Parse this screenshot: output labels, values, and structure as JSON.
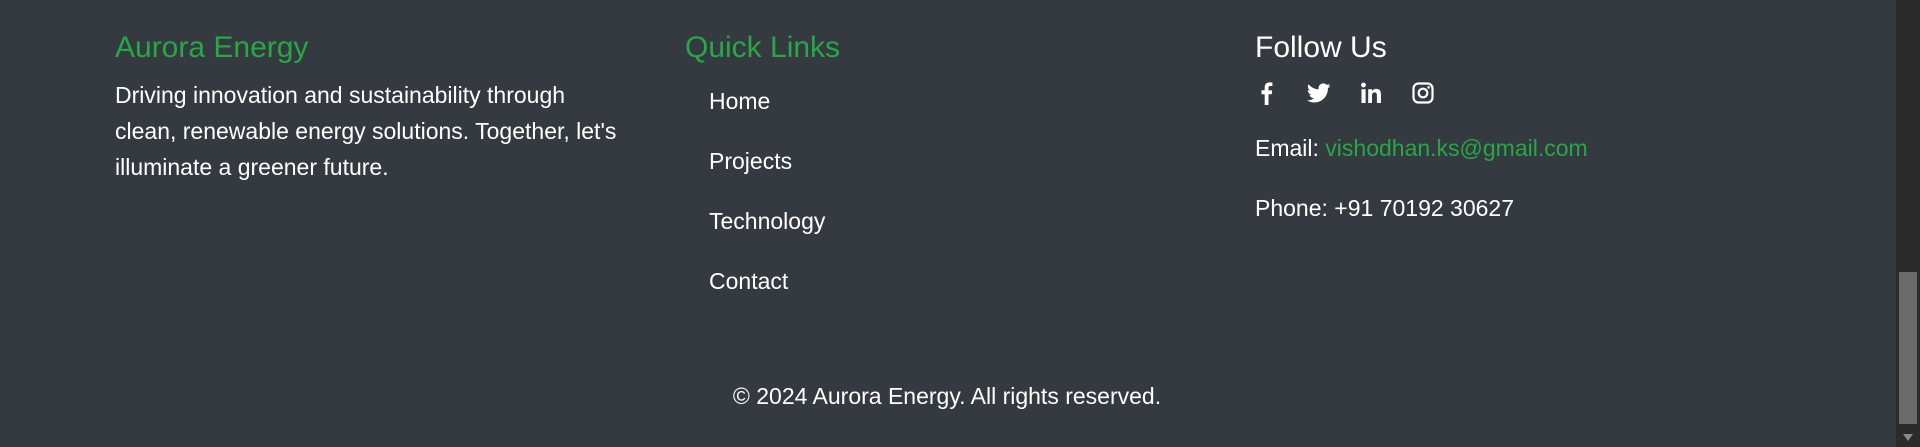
{
  "about": {
    "title": "Aurora Energy",
    "description_line1": "Driving innovation and sustainability through",
    "description_line2": "clean, renewable energy solutions. Together, let's",
    "description_line3": "illuminate a greener future."
  },
  "quick_links": {
    "title": "Quick Links",
    "items": [
      {
        "label": "Home"
      },
      {
        "label": "Projects"
      },
      {
        "label": "Technology"
      },
      {
        "label": "Contact"
      }
    ]
  },
  "follow": {
    "title": "Follow Us",
    "icons": [
      "facebook-icon",
      "twitter-icon",
      "linkedin-icon",
      "instagram-icon"
    ],
    "email_label": "Email:",
    "email_value": "vishodhan.ks@gmail.com",
    "phone_text": "Phone: +91 70192 30627"
  },
  "footer": {
    "copyright": "© 2024 Aurora Energy. All rights reserved."
  },
  "colors": {
    "background": "#343a40",
    "accent": "#28a745",
    "text": "#ffffff"
  }
}
